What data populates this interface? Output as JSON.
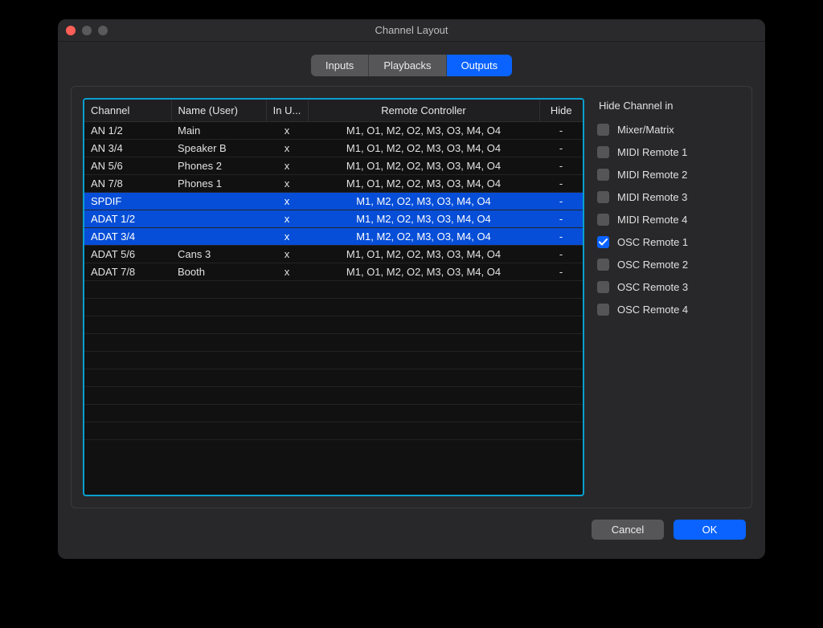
{
  "window": {
    "title": "Channel Layout"
  },
  "tabs": [
    {
      "label": "Inputs",
      "active": false
    },
    {
      "label": "Playbacks",
      "active": false
    },
    {
      "label": "Outputs",
      "active": true
    }
  ],
  "table": {
    "headers": {
      "channel": "Channel",
      "name": "Name (User)",
      "inUse": "In U...",
      "remote": "Remote Controller",
      "hide": "Hide"
    },
    "rows": [
      {
        "channel": "AN 1/2",
        "name": "Main",
        "inUse": "x",
        "remote": "M1, O1, M2, O2, M3, O3, M4, O4",
        "hide": "-",
        "selected": false
      },
      {
        "channel": "AN 3/4",
        "name": "Speaker B",
        "inUse": "x",
        "remote": "M1, O1, M2, O2, M3, O3, M4, O4",
        "hide": "-",
        "selected": false
      },
      {
        "channel": "AN 5/6",
        "name": "Phones 2",
        "inUse": "x",
        "remote": "M1, O1, M2, O2, M3, O3, M4, O4",
        "hide": "-",
        "selected": false
      },
      {
        "channel": "AN 7/8",
        "name": "Phones 1",
        "inUse": "x",
        "remote": "M1, O1, M2, O2, M3, O3, M4, O4",
        "hide": "-",
        "selected": false
      },
      {
        "channel": "SPDIF",
        "name": "",
        "inUse": "x",
        "remote": "M1, M2, O2, M3, O3, M4, O4",
        "hide": "-",
        "selected": true
      },
      {
        "channel": "ADAT 1/2",
        "name": "",
        "inUse": "x",
        "remote": "M1, M2, O2, M3, O3, M4, O4",
        "hide": "-",
        "selected": true
      },
      {
        "channel": "ADAT 3/4",
        "name": "",
        "inUse": "x",
        "remote": "M1, M2, O2, M3, O3, M4, O4",
        "hide": "-",
        "selected": true
      },
      {
        "channel": "ADAT 5/6",
        "name": "Cans 3",
        "inUse": "x",
        "remote": "M1, O1, M2, O2, M3, O3, M4, O4",
        "hide": "-",
        "selected": false
      },
      {
        "channel": "ADAT 7/8",
        "name": "Booth",
        "inUse": "x",
        "remote": "M1, O1, M2, O2, M3, O3, M4, O4",
        "hide": "-",
        "selected": false
      }
    ],
    "emptyRowCount": 9
  },
  "sidebar": {
    "title": "Hide Channel in",
    "items": [
      {
        "label": "Mixer/Matrix",
        "checked": false
      },
      {
        "label": "MIDI Remote 1",
        "checked": false
      },
      {
        "label": "MIDI Remote 2",
        "checked": false
      },
      {
        "label": "MIDI Remote 3",
        "checked": false
      },
      {
        "label": "MIDI Remote 4",
        "checked": false
      },
      {
        "label": "OSC Remote 1",
        "checked": true
      },
      {
        "label": "OSC Remote 2",
        "checked": false
      },
      {
        "label": "OSC Remote 3",
        "checked": false
      },
      {
        "label": "OSC Remote 4",
        "checked": false
      }
    ]
  },
  "actions": {
    "cancel": "Cancel",
    "ok": "OK"
  }
}
